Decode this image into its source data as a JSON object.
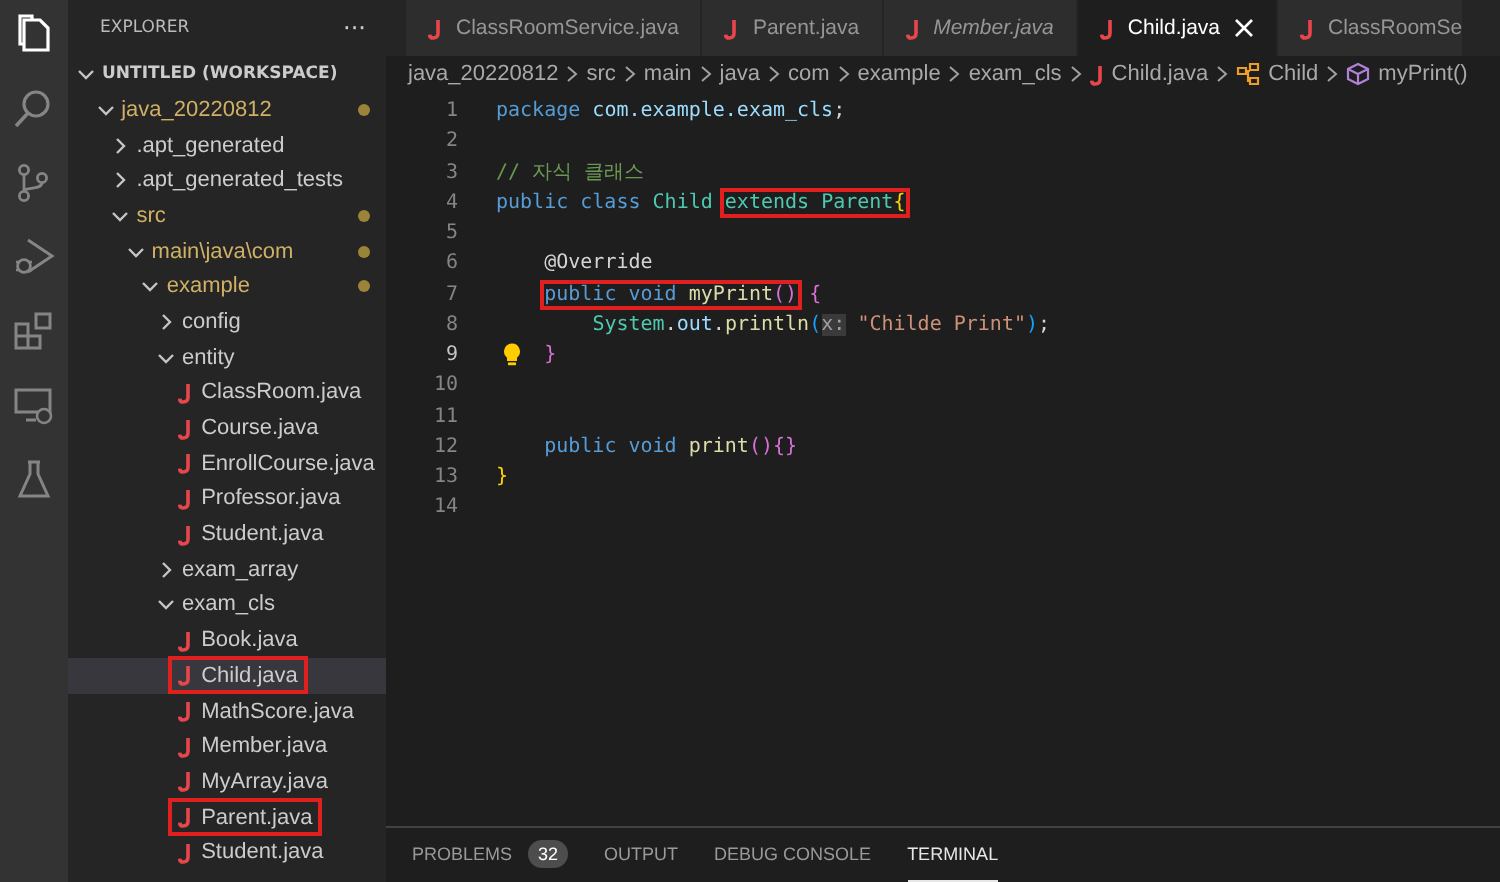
{
  "activity_bar": [
    {
      "kind": "files",
      "selected": true
    },
    {
      "kind": "search",
      "selected": false
    },
    {
      "kind": "source-control",
      "selected": false
    },
    {
      "kind": "run-debug",
      "selected": false
    },
    {
      "kind": "extensions",
      "selected": false
    },
    {
      "kind": "remote",
      "selected": false
    },
    {
      "kind": "testing",
      "selected": false
    }
  ],
  "sidebar": {
    "title": "EXPLORER",
    "more": "···",
    "workspace": {
      "label": "UNTITLED (WORKSPACE)",
      "expanded": true
    },
    "tree": [
      {
        "kind": "folder",
        "label": "java_20220812",
        "expanded": true,
        "modified": true,
        "children": [
          {
            "kind": "folder",
            "label": ".apt_generated",
            "expanded": false,
            "modified": false
          },
          {
            "kind": "folder",
            "label": ".apt_generated_tests",
            "expanded": false,
            "modified": false
          },
          {
            "kind": "folder",
            "label": "src",
            "expanded": true,
            "modified": true,
            "children": [
              {
                "kind": "folder",
                "label": "main\\java\\com",
                "expanded": true,
                "modified": true,
                "children": [
                  {
                    "kind": "folder",
                    "label": "example",
                    "expanded": true,
                    "modified": true,
                    "children": [
                      {
                        "kind": "folder",
                        "label": "config",
                        "expanded": false,
                        "modified": false
                      },
                      {
                        "kind": "folder",
                        "label": "entity",
                        "expanded": true,
                        "modified": false,
                        "children": [
                          {
                            "kind": "file",
                            "label": "ClassRoom.java",
                            "selected": false,
                            "boxed": false
                          },
                          {
                            "kind": "file",
                            "label": "Course.java",
                            "selected": false,
                            "boxed": false
                          },
                          {
                            "kind": "file",
                            "label": "EnrollCourse.java",
                            "selected": false,
                            "boxed": false
                          },
                          {
                            "kind": "file",
                            "label": "Professor.java",
                            "selected": false,
                            "boxed": false
                          },
                          {
                            "kind": "file",
                            "label": "Student.java",
                            "selected": false,
                            "boxed": false
                          }
                        ]
                      },
                      {
                        "kind": "folder",
                        "label": "exam_array",
                        "expanded": false,
                        "modified": false
                      },
                      {
                        "kind": "folder",
                        "label": "exam_cls",
                        "expanded": true,
                        "modified": false,
                        "children": [
                          {
                            "kind": "file",
                            "label": "Book.java",
                            "selected": false,
                            "boxed": false
                          },
                          {
                            "kind": "file",
                            "label": "Child.java",
                            "selected": true,
                            "boxed": true
                          },
                          {
                            "kind": "file",
                            "label": "MathScore.java",
                            "selected": false,
                            "boxed": false
                          },
                          {
                            "kind": "file",
                            "label": "Member.java",
                            "selected": false,
                            "boxed": false
                          },
                          {
                            "kind": "file",
                            "label": "MyArray.java",
                            "selected": false,
                            "boxed": false
                          },
                          {
                            "kind": "file",
                            "label": "Parent.java",
                            "selected": false,
                            "boxed": true
                          },
                          {
                            "kind": "file",
                            "label": "Student.java",
                            "selected": false,
                            "boxed": false
                          }
                        ]
                      }
                    ]
                  }
                ]
              }
            ]
          }
        ]
      }
    ]
  },
  "tabs": [
    {
      "label": "ClassRoomService.java",
      "selected": false,
      "preview": false
    },
    {
      "label": "Parent.java",
      "selected": false,
      "preview": false
    },
    {
      "label": "Member.java",
      "selected": false,
      "preview": true
    },
    {
      "label": "Child.java",
      "selected": true,
      "preview": false
    },
    {
      "label": "ClassRoomSe",
      "selected": false,
      "preview": false
    }
  ],
  "breadcrumbs": [
    {
      "kind": "folder",
      "text": "java_20220812"
    },
    {
      "kind": "folder",
      "text": "src"
    },
    {
      "kind": "folder",
      "text": "main"
    },
    {
      "kind": "folder",
      "text": "java"
    },
    {
      "kind": "folder",
      "text": "com"
    },
    {
      "kind": "folder",
      "text": "example"
    },
    {
      "kind": "folder",
      "text": "exam_cls"
    },
    {
      "kind": "java",
      "text": "Child.java"
    },
    {
      "kind": "class",
      "text": "Child"
    },
    {
      "kind": "method",
      "text": "myPrint()"
    }
  ],
  "code": [
    {
      "number": "1",
      "current": false,
      "segments": [
        {
          "kind": "text",
          "tokens": [
            {
              "kind": "keyword",
              "text": "package "
            },
            {
              "kind": "variable",
              "text": "com.example.exam_cls"
            },
            {
              "kind": "plain",
              "text": ";"
            }
          ]
        }
      ]
    },
    {
      "number": "2",
      "current": false
    },
    {
      "number": "3",
      "current": false,
      "segments": [
        {
          "kind": "text",
          "tokens": [
            {
              "kind": "comment",
              "text": "// 자식 클래스"
            }
          ]
        }
      ]
    },
    {
      "number": "4",
      "current": false,
      "segments": [
        {
          "kind": "text",
          "tokens": [
            {
              "kind": "keyword",
              "text": "public class "
            },
            {
              "kind": "type",
              "text": "Child "
            }
          ]
        },
        {
          "kind": "box",
          "tokens": [
            {
              "kind": "type",
              "text": "extends Parent"
            },
            {
              "kind": "brace",
              "text": "{"
            }
          ]
        }
      ],
      "children": [
        {
          "number": "5",
          "current": false
        },
        {
          "number": "6",
          "current": false,
          "segments": [
            {
              "kind": "text",
              "tokens": [
                {
                  "kind": "annotation",
                  "text": "@Override"
                }
              ]
            }
          ]
        },
        {
          "number": "7",
          "current": false,
          "segments": [
            {
              "kind": "box",
              "tokens": [
                {
                  "kind": "keyword",
                  "text": "public void "
                },
                {
                  "kind": "method",
                  "text": "myPrint"
                },
                {
                  "kind": "brace2",
                  "text": "()"
                }
              ]
            },
            {
              "kind": "text",
              "tokens": [
                {
                  "kind": "brace2",
                  "text": " {"
                }
              ]
            }
          ],
          "children": [
            {
              "number": "8",
              "current": false,
              "segments": [
                {
                  "kind": "text",
                  "tokens": [
                    {
                      "kind": "type",
                      "text": "System"
                    },
                    {
                      "kind": "plain",
                      "text": "."
                    },
                    {
                      "kind": "variable",
                      "text": "out"
                    },
                    {
                      "kind": "plain",
                      "text": "."
                    },
                    {
                      "kind": "method",
                      "text": "println"
                    },
                    {
                      "kind": "brace3",
                      "text": "("
                    },
                    {
                      "kind": "hint",
                      "text": "x:"
                    },
                    {
                      "kind": "string",
                      "text": " \"Childe Print\""
                    },
                    {
                      "kind": "brace3",
                      "text": ")"
                    },
                    {
                      "kind": "plain",
                      "text": ";"
                    }
                  ]
                }
              ]
            }
          ]
        },
        {
          "number": "9",
          "current": true,
          "lightbulb": true,
          "segments": [
            {
              "kind": "text",
              "tokens": [
                {
                  "kind": "brace2",
                  "text": "}"
                }
              ]
            }
          ]
        },
        {
          "number": "10",
          "current": false
        },
        {
          "number": "11",
          "current": false
        },
        {
          "number": "12",
          "current": false,
          "segments": [
            {
              "kind": "text",
              "tokens": [
                {
                  "kind": "keyword",
                  "text": "public void "
                },
                {
                  "kind": "method",
                  "text": "print"
                },
                {
                  "kind": "brace2",
                  "text": "()"
                },
                {
                  "kind": "brace2",
                  "text": "{}"
                }
              ]
            }
          ]
        }
      ]
    },
    {
      "number": "13",
      "current": false,
      "segments": [
        {
          "kind": "text",
          "tokens": [
            {
              "kind": "brace",
              "text": "}"
            }
          ]
        }
      ]
    },
    {
      "number": "14",
      "current": false
    }
  ],
  "panel_tabs": [
    {
      "label": "PROBLEMS",
      "badge": "32",
      "selected": false
    },
    {
      "label": "OUTPUT",
      "selected": false
    },
    {
      "label": "DEBUG CONSOLE",
      "selected": false
    },
    {
      "label": "TERMINAL",
      "selected": true
    }
  ]
}
